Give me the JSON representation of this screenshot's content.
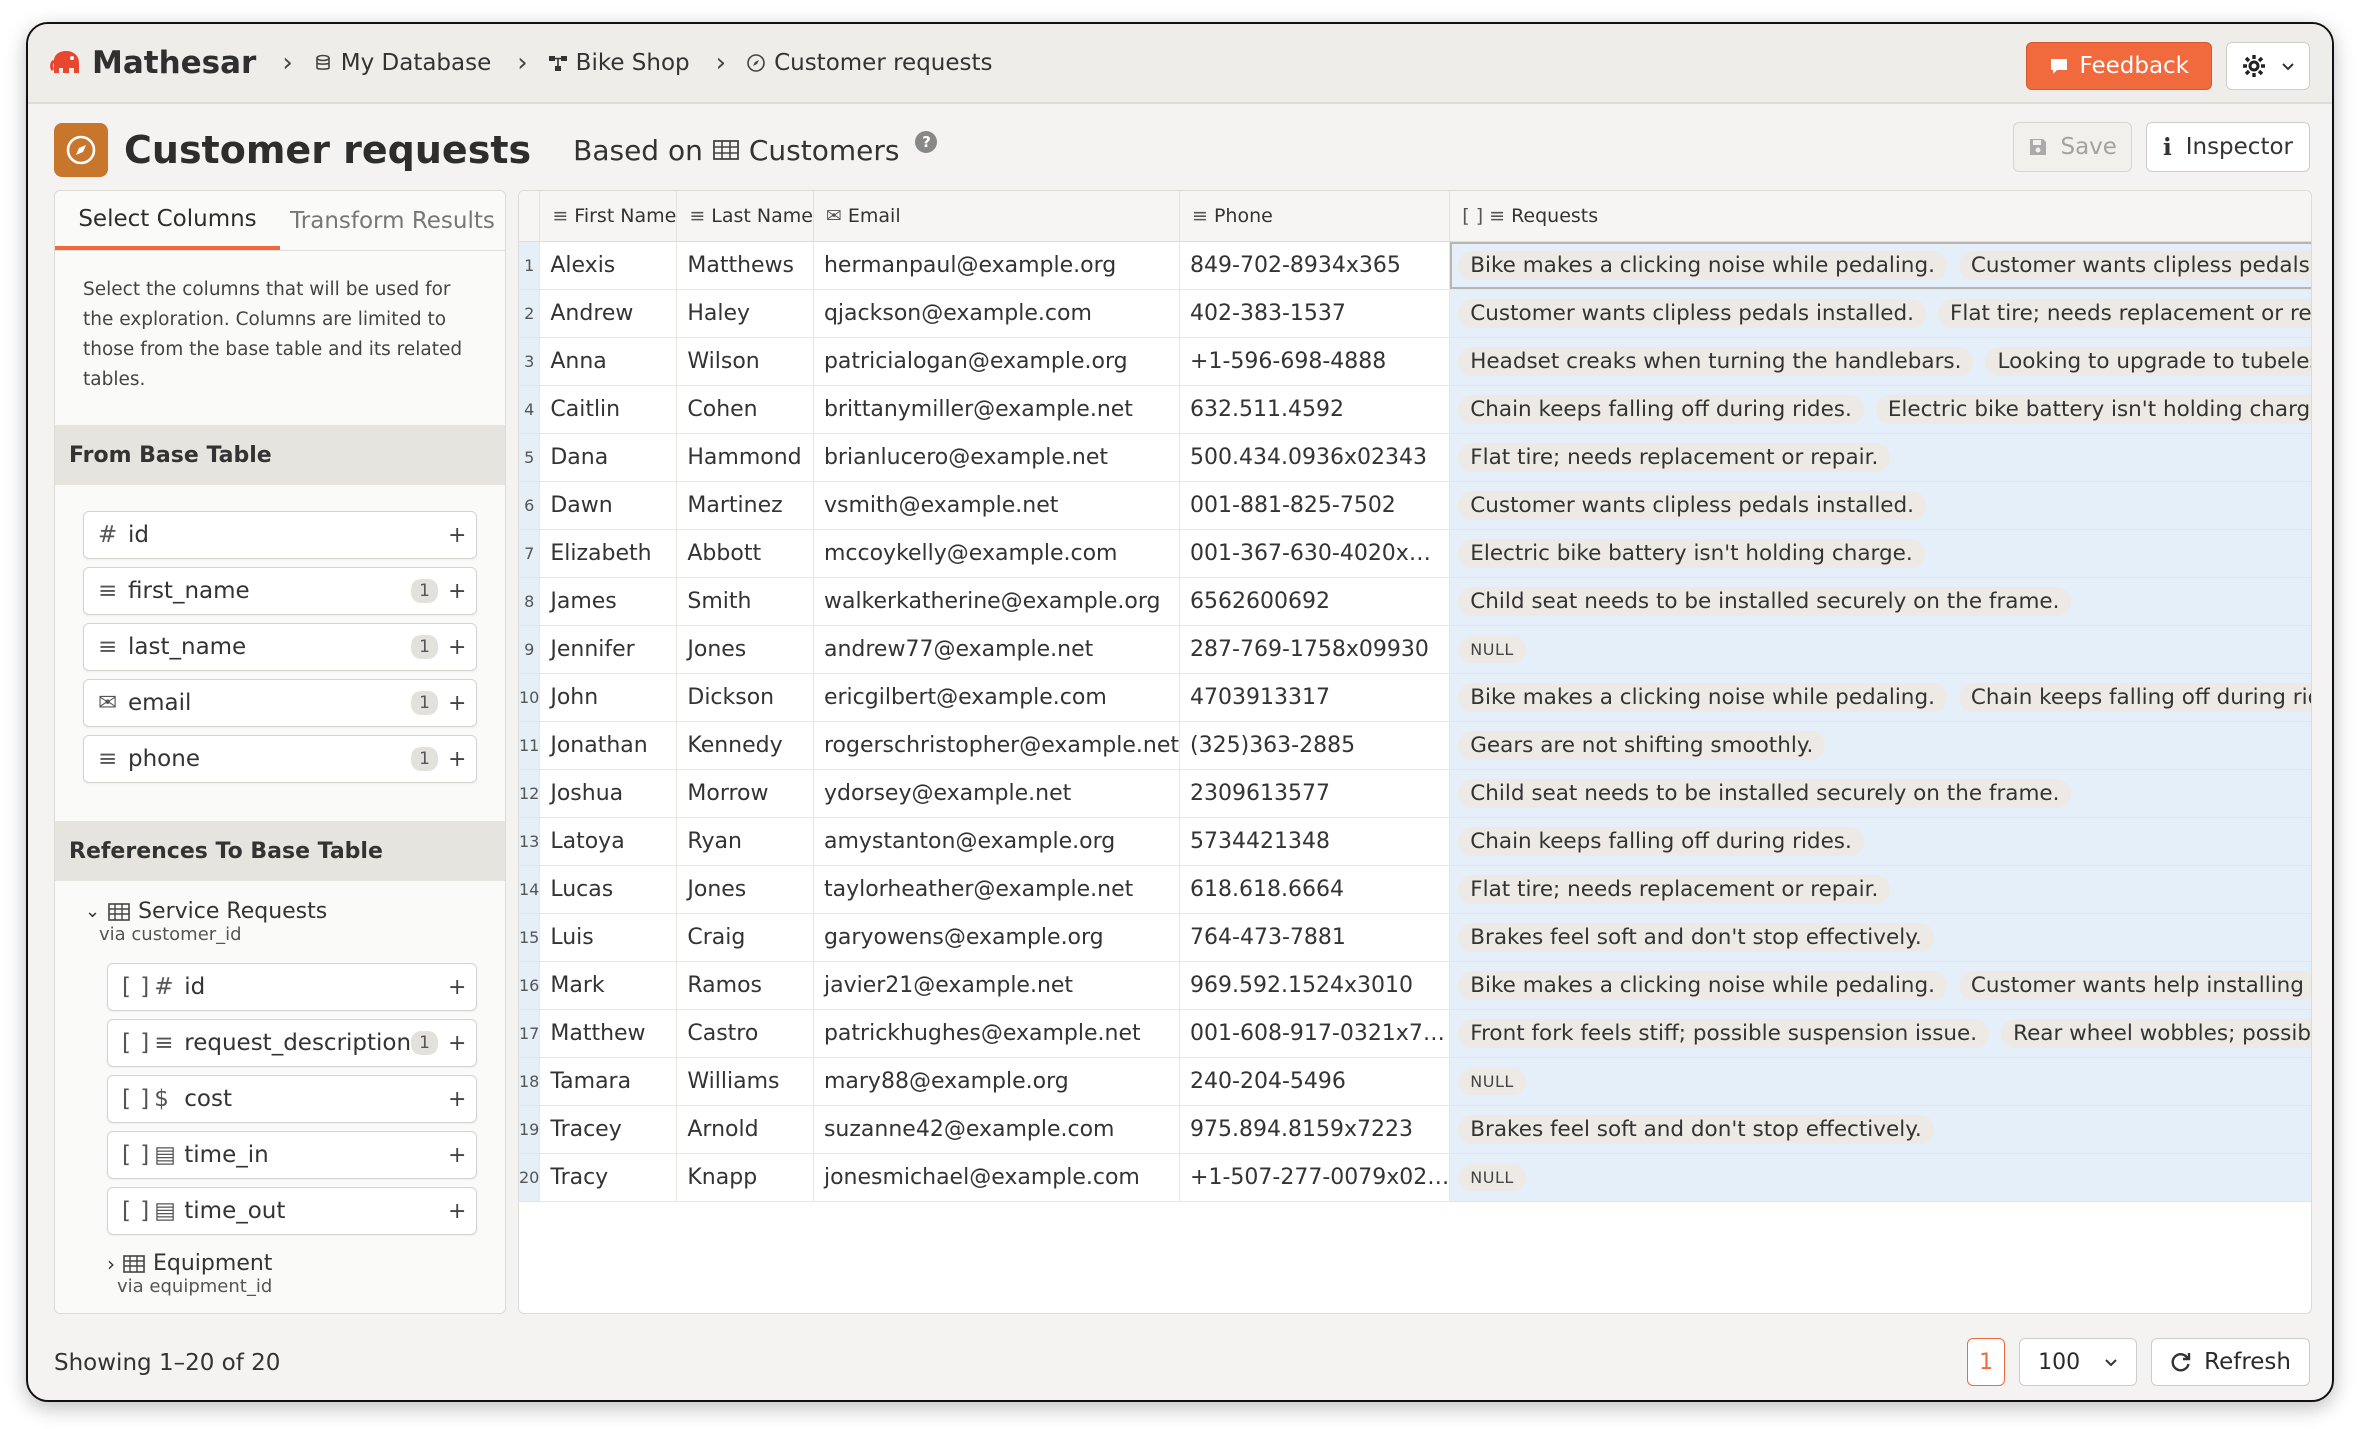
{
  "app": {
    "name": "Mathesar"
  },
  "breadcrumb": [
    {
      "label": "My Database",
      "icon": "database-icon"
    },
    {
      "label": "Bike Shop",
      "icon": "schema-icon"
    },
    {
      "label": "Customer requests",
      "icon": "compass-icon"
    }
  ],
  "topbar": {
    "feedback_label": "Feedback"
  },
  "page": {
    "title": "Customer requests",
    "based_on_label": "Based on",
    "base_table": "Customers",
    "help": "?",
    "save_label": "Save",
    "inspector_label": "Inspector",
    "inspector_icon_text": "i"
  },
  "left_panel": {
    "tabs": [
      "Select Columns",
      "Transform Results"
    ],
    "description": "Select the columns that will be used for the exploration. Columns are limited to those from the base table and its related tables.",
    "base_section_title": "From Base Table",
    "base_columns": [
      {
        "name": "id",
        "icon": "hash-icon",
        "count": ""
      },
      {
        "name": "first_name",
        "icon": "text-icon",
        "count": "1"
      },
      {
        "name": "last_name",
        "icon": "text-icon",
        "count": "1"
      },
      {
        "name": "email",
        "icon": "email-icon",
        "count": "1"
      },
      {
        "name": "phone",
        "icon": "text-icon",
        "count": "1"
      }
    ],
    "refs_section_title": "References To Base Table",
    "ref_table": {
      "name": "Service Requests",
      "via": "via customer_id",
      "columns": [
        {
          "name": "id",
          "icon": "hash-icon",
          "count": ""
        },
        {
          "name": "request_description",
          "icon": "text-icon",
          "count": "1"
        },
        {
          "name": "cost",
          "icon": "dollar-icon",
          "count": ""
        },
        {
          "name": "time_in",
          "icon": "calendar-icon",
          "count": ""
        },
        {
          "name": "time_out",
          "icon": "calendar-icon",
          "count": ""
        }
      ]
    },
    "ref_table_2": {
      "name": "Equipment",
      "via": "via equipment_id"
    },
    "array_bracket": "[ ]",
    "plus": "+"
  },
  "table": {
    "headers": [
      "First Name",
      "Last Name",
      "Email",
      "Phone",
      "Requests"
    ],
    "rows": [
      {
        "n": "1",
        "first": "Alexis",
        "last": "Matthews",
        "email": "hermanpaul@example.org",
        "phone": "849-702-8934x365",
        "requests": [
          "Bike makes a clicking noise while pedaling.",
          "Customer wants clipless pedals installed."
        ]
      },
      {
        "n": "2",
        "first": "Andrew",
        "last": "Haley",
        "email": "qjackson@example.com",
        "phone": "402-383-1537",
        "requests": [
          "Customer wants clipless pedals installed.",
          "Flat tire; needs replacement or repair."
        ]
      },
      {
        "n": "3",
        "first": "Anna",
        "last": "Wilson",
        "email": "patricialogan@example.org",
        "phone": "+1-596-698-4888",
        "requests": [
          "Headset creaks when turning the handlebars.",
          "Looking to upgrade to tubeless tires."
        ]
      },
      {
        "n": "4",
        "first": "Caitlin",
        "last": "Cohen",
        "email": "brittanymiller@example.net",
        "phone": "632.511.4592",
        "requests": [
          "Chain keeps falling off during rides.",
          "Electric bike battery isn't holding charge."
        ]
      },
      {
        "n": "5",
        "first": "Dana",
        "last": "Hammond",
        "email": "brianlucero@example.net",
        "phone": "500.434.0936x02343",
        "requests": [
          "Flat tire; needs replacement or repair."
        ]
      },
      {
        "n": "6",
        "first": "Dawn",
        "last": "Martinez",
        "email": "vsmith@example.net",
        "phone": "001-881-825-7502",
        "requests": [
          "Customer wants clipless pedals installed."
        ]
      },
      {
        "n": "7",
        "first": "Elizabeth",
        "last": "Abbott",
        "email": "mccoykelly@example.com",
        "phone": "001-367-630-4020x…",
        "requests": [
          "Electric bike battery isn't holding charge."
        ]
      },
      {
        "n": "8",
        "first": "James",
        "last": "Smith",
        "email": "walkerkatherine@example.org",
        "phone": "6562600692",
        "requests": [
          "Child seat needs to be installed securely on the frame."
        ]
      },
      {
        "n": "9",
        "first": "Jennifer",
        "last": "Jones",
        "email": "andrew77@example.net",
        "phone": "287-769-1758x09930",
        "requests": []
      },
      {
        "n": "10",
        "first": "John",
        "last": "Dickson",
        "email": "ericgilbert@example.com",
        "phone": "4703913317",
        "requests": [
          "Bike makes a clicking noise while pedaling.",
          "Chain keeps falling off during rides."
        ]
      },
      {
        "n": "11",
        "first": "Jonathan",
        "last": "Kennedy",
        "email": "rogerschristopher@example.net",
        "phone": "(325)363-2885",
        "requests": [
          "Gears are not shifting smoothly."
        ]
      },
      {
        "n": "12",
        "first": "Joshua",
        "last": "Morrow",
        "email": "ydorsey@example.net",
        "phone": "2309613577",
        "requests": [
          "Child seat needs to be installed securely on the frame."
        ]
      },
      {
        "n": "13",
        "first": "Latoya",
        "last": "Ryan",
        "email": "amystanton@example.org",
        "phone": "5734421348",
        "requests": [
          "Chain keeps falling off during rides."
        ]
      },
      {
        "n": "14",
        "first": "Lucas",
        "last": "Jones",
        "email": "taylorheather@example.net",
        "phone": "618.618.6664",
        "requests": [
          "Flat tire; needs replacement or repair."
        ]
      },
      {
        "n": "15",
        "first": "Luis",
        "last": "Craig",
        "email": "garyowens@example.org",
        "phone": "764-473-7881",
        "requests": [
          "Brakes feel soft and don't stop effectively."
        ]
      },
      {
        "n": "16",
        "first": "Mark",
        "last": "Ramos",
        "email": "javier21@example.net",
        "phone": "969.592.1524x3010",
        "requests": [
          "Bike makes a clicking noise while pedaling.",
          "Customer wants help installing"
        ]
      },
      {
        "n": "17",
        "first": "Matthew",
        "last": "Castro",
        "email": "patrickhughes@example.net",
        "phone": "001-608-917-0321x7…",
        "requests": [
          "Front fork feels stiff; possible suspension issue.",
          "Rear wheel wobbles; possible"
        ]
      },
      {
        "n": "18",
        "first": "Tamara",
        "last": "Williams",
        "email": "mary88@example.org",
        "phone": "240-204-5496",
        "requests": []
      },
      {
        "n": "19",
        "first": "Tracey",
        "last": "Arnold",
        "email": "suzanne42@example.com",
        "phone": "975.894.8159x7223",
        "requests": [
          "Brakes feel soft and don't stop effectively."
        ]
      },
      {
        "n": "20",
        "first": "Tracy",
        "last": "Knapp",
        "email": "jonesmichael@example.com",
        "phone": "+1-507-277-0079x02…",
        "requests": []
      }
    ],
    "null_label": "NULL"
  },
  "footer": {
    "showing": "Showing 1–20 of 20",
    "page": "1",
    "page_size": "100",
    "refresh_label": "Refresh"
  },
  "colors": {
    "accent": "#f06a3d",
    "page_icon": "#c8762b",
    "array_cell_bg": "#e4effa"
  }
}
